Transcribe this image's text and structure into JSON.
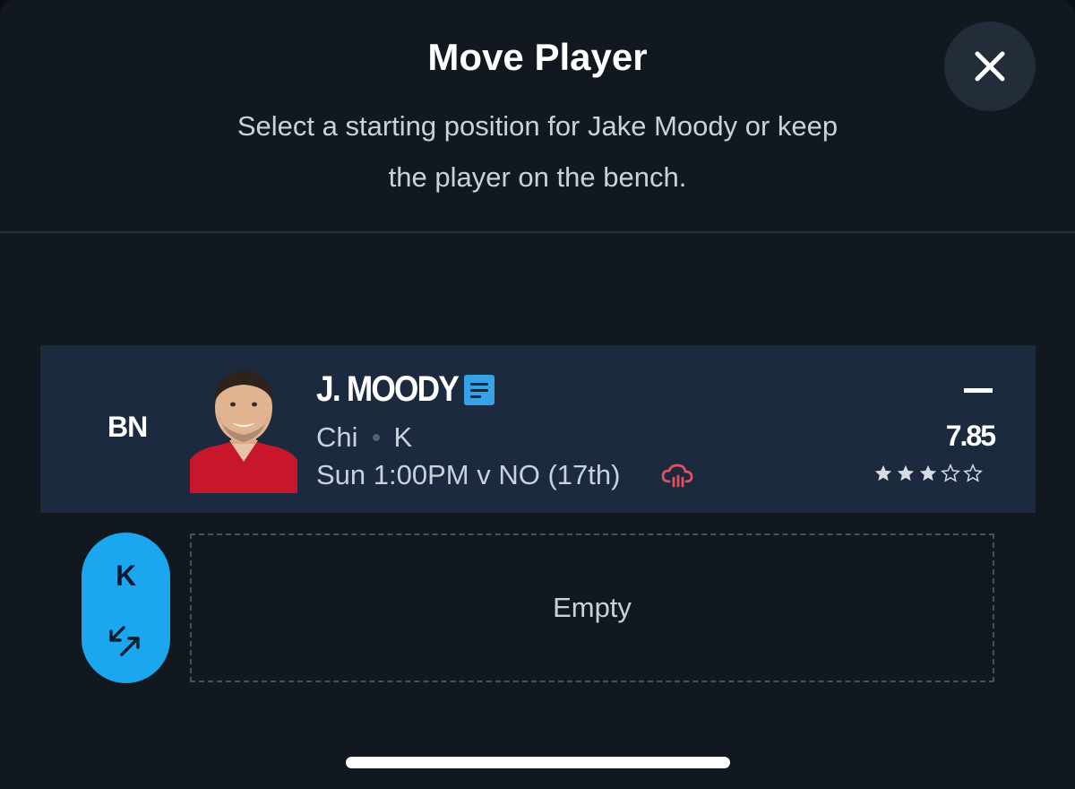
{
  "header": {
    "title": "Move Player",
    "subtitle": "Select a starting position for Jake Moody or keep the player on the bench.",
    "close_icon": "close-icon"
  },
  "player": {
    "slot": "BN",
    "name": "J. MOODY",
    "note_icon": "news-note-icon",
    "team": "Chi",
    "position": "K",
    "game": "Sun 1:00PM v NO (17th)",
    "weather_icon": "rain-cloud-icon",
    "projection_dash": "–",
    "projected_points": "7.85",
    "rating": 3,
    "rating_max": 5
  },
  "empty_slot": {
    "position": "K",
    "label": "Empty",
    "swap_icon": "swap-arrows-icon"
  },
  "colors": {
    "background": "#111820",
    "row_background": "#1b2a3e",
    "accent": "#1ba7ef",
    "weather": "#e0505f"
  }
}
